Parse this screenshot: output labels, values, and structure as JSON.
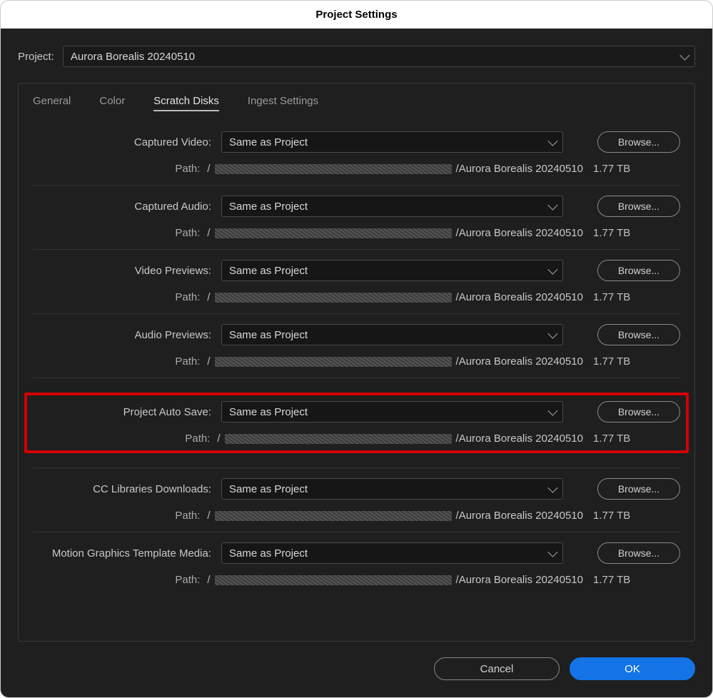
{
  "window": {
    "title": "Project Settings"
  },
  "project": {
    "label": "Project:",
    "value": "Aurora Borealis 20240510"
  },
  "tabs": {
    "general": "General",
    "color": "Color",
    "scratch": "Scratch Disks",
    "ingest": "Ingest Settings"
  },
  "common": {
    "browse": "Browse...",
    "path_label": "Path:",
    "slash": "/",
    "path_tail": "/Aurora Borealis 20240510",
    "size": "1.77 TB",
    "dropdown_value": "Same as Project"
  },
  "sections": [
    {
      "label": "Captured Video:",
      "highlight": false,
      "redacted_w": 354
    },
    {
      "label": "Captured Audio:",
      "highlight": false,
      "redacted_w": 354
    },
    {
      "label": "Video Previews:",
      "highlight": false,
      "redacted_w": 354
    },
    {
      "label": "Audio Previews:",
      "highlight": false,
      "redacted_w": 354
    },
    {
      "label": "Project Auto Save:",
      "highlight": true,
      "redacted_w": 320
    },
    {
      "label": "CC Libraries Downloads:",
      "highlight": false,
      "redacted_w": 354
    },
    {
      "label": "Motion Graphics Template Media:",
      "highlight": false,
      "redacted_w": 354
    }
  ],
  "footer": {
    "cancel": "Cancel",
    "ok": "OK"
  }
}
